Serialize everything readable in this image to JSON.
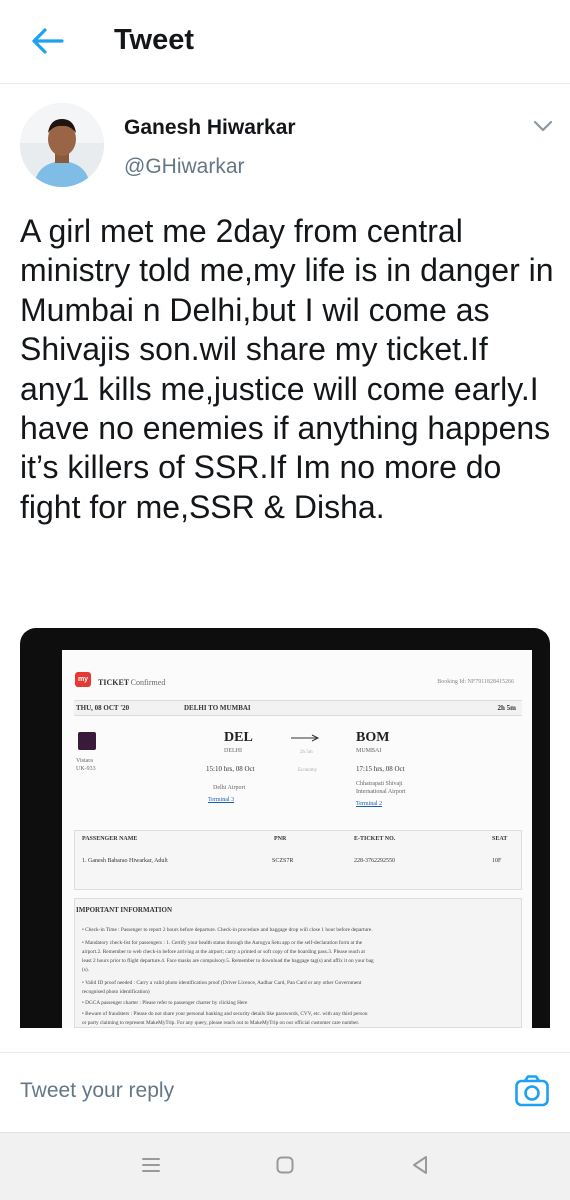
{
  "header": {
    "title": "Tweet",
    "back_icon": "arrow-left-icon",
    "accent": "#1da1f2"
  },
  "tweet": {
    "author_name": "Ganesh Hiwarkar",
    "handle": "@GHiwarkar",
    "menu_icon": "chevron-down-icon",
    "text": "A girl met me 2day from central ministry told me,my life is in danger in Mumbai n Delhi,but I wil come as Shivajis son.wil share my ticket.If any1 kills me,justice will come early.I have no enemies if anything happens it’s killers of SSR.If Im no more do fight for me,SSR & Disha."
  },
  "ticket": {
    "logo": "my",
    "label": "TICKET",
    "status": "- Confirmed",
    "booking_id": "Booking Id: NF7911828415266",
    "date": "THU, 08 OCT '20",
    "route": "DELHI TO MUMBAI",
    "duration": "2h 5m",
    "airline": "Vistara",
    "flight_no": "UK-933",
    "from_code": "DEL",
    "from_city": "DELHI",
    "from_time": "15:10 hrs, 08 Oct",
    "from_airport": "Delhi Airport",
    "from_terminal": "Terminal 3",
    "mid_duration": "2h 5m",
    "cabin": "Economy",
    "to_code": "BOM",
    "to_city": "MUMBAI",
    "to_time": "17:15 hrs, 08 Oct",
    "to_airport_1": "Chhatrapati Shivaji",
    "to_airport_2": "International Airport",
    "to_terminal": "Terminal 2",
    "pax_headers": {
      "name": "PASSENGER NAME",
      "pnr": "PNR",
      "eticket": "E-TICKET NO.",
      "seat": "SEAT"
    },
    "passenger": {
      "name": "1. Ganesh Babarao Hiwarkar, Adult",
      "pnr": "SCZS7R",
      "eticket": "228-3762292550",
      "seat": "10F"
    },
    "info_heading": "IMPORTANT INFORMATION",
    "info_lines": [
      "• Check-in Time : Passenger to report 2 hours before departure. Check-in procedure and baggage drop will close 1 hour before departure.",
      "• Mandatory check-list for passengers : 1. Certify your health status through the Aarogya Setu app or the self-declaration form at the",
      "   airport.2. Remember to web check-in before arriving at the airport; carry a printed or soft copy of the boarding pass.3. Please reach at",
      "   least 2 hours prior to flight departure.4. Face masks are compulsory.5. Remember to download the baggage tag(s) and affix it on your bag",
      "   (s).",
      "• Valid ID proof needed : Carry a valid photo identification proof (Driver Licence, Aadhar Card, Pan Card or any other Government",
      "   recognised photo identification)",
      "• DGCA passenger charter : Please refer to passenger charter by clicking Here",
      "• Beware of fraudsters : Please do not share your personal banking and security details like passwords, CVV, etc. with any third person",
      "   or party claiming to represent MakeMyTrip. For any query, please reach out to MakeMyTrip on our official customer care number."
    ]
  },
  "reply": {
    "placeholder": "Tweet your reply",
    "camera_icon": "camera-icon"
  },
  "navbar": {
    "menu_icon": "menu-icon",
    "home_icon": "home-icon",
    "back_icon": "back-triangle-icon"
  }
}
